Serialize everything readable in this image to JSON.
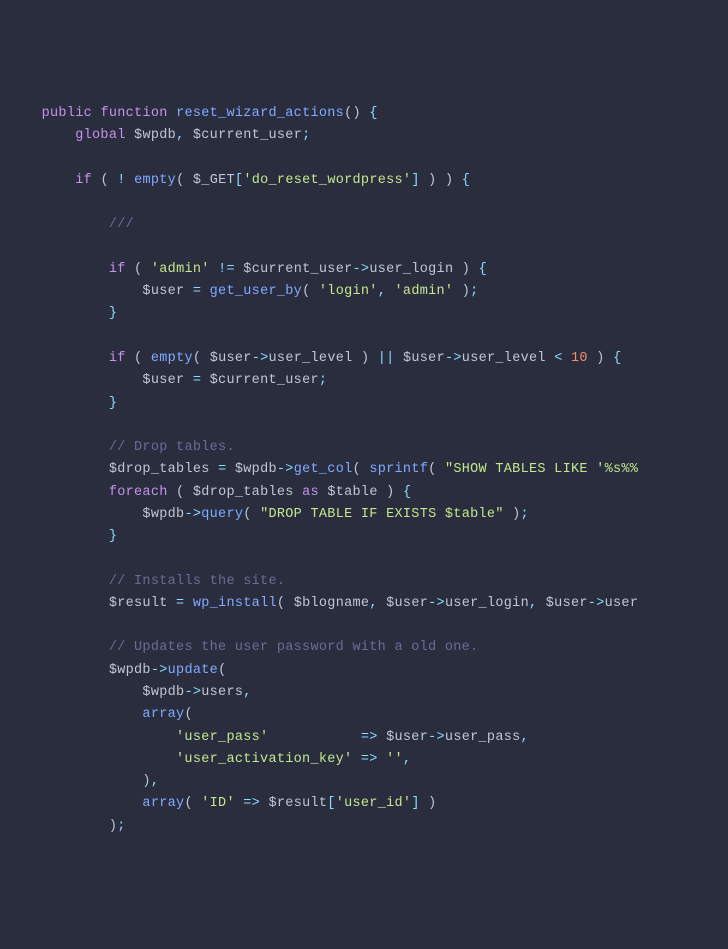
{
  "code": {
    "lines": [
      {
        "indent": 1,
        "tokens": [
          {
            "t": "kw",
            "v": "public"
          },
          {
            "t": "sp",
            "v": " "
          },
          {
            "t": "kw",
            "v": "function"
          },
          {
            "t": "sp",
            "v": " "
          },
          {
            "t": "fn",
            "v": "reset_wizard_actions"
          },
          {
            "t": "paren",
            "v": "()"
          },
          {
            "t": "sp",
            "v": " "
          },
          {
            "t": "punc",
            "v": "{"
          }
        ]
      },
      {
        "indent": 2,
        "tokens": [
          {
            "t": "kw",
            "v": "global"
          },
          {
            "t": "sp",
            "v": " "
          },
          {
            "t": "var",
            "v": "$wpdb"
          },
          {
            "t": "punc",
            "v": ","
          },
          {
            "t": "sp",
            "v": " "
          },
          {
            "t": "var",
            "v": "$current_user"
          },
          {
            "t": "punc",
            "v": ";"
          }
        ]
      },
      {
        "indent": 0,
        "tokens": []
      },
      {
        "indent": 2,
        "tokens": [
          {
            "t": "kw",
            "v": "if"
          },
          {
            "t": "sp",
            "v": " "
          },
          {
            "t": "paren",
            "v": "("
          },
          {
            "t": "sp",
            "v": " "
          },
          {
            "t": "op",
            "v": "!"
          },
          {
            "t": "sp",
            "v": " "
          },
          {
            "t": "fn",
            "v": "empty"
          },
          {
            "t": "paren",
            "v": "("
          },
          {
            "t": "sp",
            "v": " "
          },
          {
            "t": "var",
            "v": "$_GET"
          },
          {
            "t": "punc",
            "v": "["
          },
          {
            "t": "str",
            "v": "'do_reset_wordpress'"
          },
          {
            "t": "punc",
            "v": "]"
          },
          {
            "t": "sp",
            "v": " "
          },
          {
            "t": "paren",
            "v": ")"
          },
          {
            "t": "sp",
            "v": " "
          },
          {
            "t": "paren",
            "v": ")"
          },
          {
            "t": "sp",
            "v": " "
          },
          {
            "t": "punc",
            "v": "{"
          }
        ]
      },
      {
        "indent": 0,
        "tokens": []
      },
      {
        "indent": 3,
        "tokens": [
          {
            "t": "cmt",
            "v": "///"
          }
        ]
      },
      {
        "indent": 0,
        "tokens": []
      },
      {
        "indent": 3,
        "tokens": [
          {
            "t": "kw",
            "v": "if"
          },
          {
            "t": "sp",
            "v": " "
          },
          {
            "t": "paren",
            "v": "("
          },
          {
            "t": "sp",
            "v": " "
          },
          {
            "t": "str",
            "v": "'admin'"
          },
          {
            "t": "sp",
            "v": " "
          },
          {
            "t": "op",
            "v": "!="
          },
          {
            "t": "sp",
            "v": " "
          },
          {
            "t": "var",
            "v": "$current_user"
          },
          {
            "t": "arrow",
            "v": "->"
          },
          {
            "t": "prop",
            "v": "user_login"
          },
          {
            "t": "sp",
            "v": " "
          },
          {
            "t": "paren",
            "v": ")"
          },
          {
            "t": "sp",
            "v": " "
          },
          {
            "t": "punc",
            "v": "{"
          }
        ]
      },
      {
        "indent": 4,
        "tokens": [
          {
            "t": "var",
            "v": "$user"
          },
          {
            "t": "sp",
            "v": " "
          },
          {
            "t": "op",
            "v": "="
          },
          {
            "t": "sp",
            "v": " "
          },
          {
            "t": "fn",
            "v": "get_user_by"
          },
          {
            "t": "paren",
            "v": "("
          },
          {
            "t": "sp",
            "v": " "
          },
          {
            "t": "str",
            "v": "'login'"
          },
          {
            "t": "punc",
            "v": ","
          },
          {
            "t": "sp",
            "v": " "
          },
          {
            "t": "str",
            "v": "'admin'"
          },
          {
            "t": "sp",
            "v": " "
          },
          {
            "t": "paren",
            "v": ")"
          },
          {
            "t": "punc",
            "v": ";"
          }
        ]
      },
      {
        "indent": 3,
        "tokens": [
          {
            "t": "punc",
            "v": "}"
          }
        ]
      },
      {
        "indent": 0,
        "tokens": []
      },
      {
        "indent": 3,
        "tokens": [
          {
            "t": "kw",
            "v": "if"
          },
          {
            "t": "sp",
            "v": " "
          },
          {
            "t": "paren",
            "v": "("
          },
          {
            "t": "sp",
            "v": " "
          },
          {
            "t": "fn",
            "v": "empty"
          },
          {
            "t": "paren",
            "v": "("
          },
          {
            "t": "sp",
            "v": " "
          },
          {
            "t": "var",
            "v": "$user"
          },
          {
            "t": "arrow",
            "v": "->"
          },
          {
            "t": "prop",
            "v": "user_level"
          },
          {
            "t": "sp",
            "v": " "
          },
          {
            "t": "paren",
            "v": ")"
          },
          {
            "t": "sp",
            "v": " "
          },
          {
            "t": "op",
            "v": "||"
          },
          {
            "t": "sp",
            "v": " "
          },
          {
            "t": "var",
            "v": "$user"
          },
          {
            "t": "arrow",
            "v": "->"
          },
          {
            "t": "prop",
            "v": "user_level"
          },
          {
            "t": "sp",
            "v": " "
          },
          {
            "t": "op",
            "v": "<"
          },
          {
            "t": "sp",
            "v": " "
          },
          {
            "t": "num",
            "v": "10"
          },
          {
            "t": "sp",
            "v": " "
          },
          {
            "t": "paren",
            "v": ")"
          },
          {
            "t": "sp",
            "v": " "
          },
          {
            "t": "punc",
            "v": "{"
          }
        ]
      },
      {
        "indent": 4,
        "tokens": [
          {
            "t": "var",
            "v": "$user"
          },
          {
            "t": "sp",
            "v": " "
          },
          {
            "t": "op",
            "v": "="
          },
          {
            "t": "sp",
            "v": " "
          },
          {
            "t": "var",
            "v": "$current_user"
          },
          {
            "t": "punc",
            "v": ";"
          }
        ]
      },
      {
        "indent": 3,
        "tokens": [
          {
            "t": "punc",
            "v": "}"
          }
        ]
      },
      {
        "indent": 0,
        "tokens": []
      },
      {
        "indent": 3,
        "tokens": [
          {
            "t": "cmt",
            "v": "// Drop tables."
          }
        ]
      },
      {
        "indent": 3,
        "tokens": [
          {
            "t": "var",
            "v": "$drop_tables"
          },
          {
            "t": "sp",
            "v": " "
          },
          {
            "t": "op",
            "v": "="
          },
          {
            "t": "sp",
            "v": " "
          },
          {
            "t": "var",
            "v": "$wpdb"
          },
          {
            "t": "arrow",
            "v": "->"
          },
          {
            "t": "fn",
            "v": "get_col"
          },
          {
            "t": "paren",
            "v": "("
          },
          {
            "t": "sp",
            "v": " "
          },
          {
            "t": "fn",
            "v": "sprintf"
          },
          {
            "t": "paren",
            "v": "("
          },
          {
            "t": "sp",
            "v": " "
          },
          {
            "t": "str",
            "v": "\"SHOW TABLES LIKE '%s%%"
          }
        ]
      },
      {
        "indent": 3,
        "tokens": [
          {
            "t": "kw",
            "v": "foreach"
          },
          {
            "t": "sp",
            "v": " "
          },
          {
            "t": "paren",
            "v": "("
          },
          {
            "t": "sp",
            "v": " "
          },
          {
            "t": "var",
            "v": "$drop_tables"
          },
          {
            "t": "sp",
            "v": " "
          },
          {
            "t": "kw",
            "v": "as"
          },
          {
            "t": "sp",
            "v": " "
          },
          {
            "t": "var",
            "v": "$table"
          },
          {
            "t": "sp",
            "v": " "
          },
          {
            "t": "paren",
            "v": ")"
          },
          {
            "t": "sp",
            "v": " "
          },
          {
            "t": "punc",
            "v": "{"
          }
        ]
      },
      {
        "indent": 4,
        "tokens": [
          {
            "t": "var",
            "v": "$wpdb"
          },
          {
            "t": "arrow",
            "v": "->"
          },
          {
            "t": "fn",
            "v": "query"
          },
          {
            "t": "paren",
            "v": "("
          },
          {
            "t": "sp",
            "v": " "
          },
          {
            "t": "str",
            "v": "\"DROP TABLE IF EXISTS $table\""
          },
          {
            "t": "sp",
            "v": " "
          },
          {
            "t": "paren",
            "v": ")"
          },
          {
            "t": "punc",
            "v": ";"
          }
        ]
      },
      {
        "indent": 3,
        "tokens": [
          {
            "t": "punc",
            "v": "}"
          }
        ]
      },
      {
        "indent": 0,
        "tokens": []
      },
      {
        "indent": 3,
        "tokens": [
          {
            "t": "cmt",
            "v": "// Installs the site."
          }
        ]
      },
      {
        "indent": 3,
        "tokens": [
          {
            "t": "var",
            "v": "$result"
          },
          {
            "t": "sp",
            "v": " "
          },
          {
            "t": "op",
            "v": "="
          },
          {
            "t": "sp",
            "v": " "
          },
          {
            "t": "fn",
            "v": "wp_install"
          },
          {
            "t": "paren",
            "v": "("
          },
          {
            "t": "sp",
            "v": " "
          },
          {
            "t": "var",
            "v": "$blogname"
          },
          {
            "t": "punc",
            "v": ","
          },
          {
            "t": "sp",
            "v": " "
          },
          {
            "t": "var",
            "v": "$user"
          },
          {
            "t": "arrow",
            "v": "->"
          },
          {
            "t": "prop",
            "v": "user_login"
          },
          {
            "t": "punc",
            "v": ","
          },
          {
            "t": "sp",
            "v": " "
          },
          {
            "t": "var",
            "v": "$user"
          },
          {
            "t": "arrow",
            "v": "->"
          },
          {
            "t": "prop",
            "v": "user"
          }
        ]
      },
      {
        "indent": 0,
        "tokens": []
      },
      {
        "indent": 3,
        "tokens": [
          {
            "t": "cmt",
            "v": "// Updates the user password with a old one."
          }
        ]
      },
      {
        "indent": 3,
        "tokens": [
          {
            "t": "var",
            "v": "$wpdb"
          },
          {
            "t": "arrow",
            "v": "->"
          },
          {
            "t": "fn",
            "v": "update"
          },
          {
            "t": "paren",
            "v": "("
          }
        ]
      },
      {
        "indent": 4,
        "tokens": [
          {
            "t": "var",
            "v": "$wpdb"
          },
          {
            "t": "arrow",
            "v": "->"
          },
          {
            "t": "prop",
            "v": "users"
          },
          {
            "t": "punc",
            "v": ","
          }
        ]
      },
      {
        "indent": 4,
        "tokens": [
          {
            "t": "fn",
            "v": "array"
          },
          {
            "t": "paren",
            "v": "("
          }
        ]
      },
      {
        "indent": 5,
        "tokens": [
          {
            "t": "str",
            "v": "'user_pass'"
          },
          {
            "t": "sp",
            "v": "           "
          },
          {
            "t": "op",
            "v": "=>"
          },
          {
            "t": "sp",
            "v": " "
          },
          {
            "t": "var",
            "v": "$user"
          },
          {
            "t": "arrow",
            "v": "->"
          },
          {
            "t": "prop",
            "v": "user_pass"
          },
          {
            "t": "punc",
            "v": ","
          }
        ]
      },
      {
        "indent": 5,
        "tokens": [
          {
            "t": "str",
            "v": "'user_activation_key'"
          },
          {
            "t": "sp",
            "v": " "
          },
          {
            "t": "op",
            "v": "=>"
          },
          {
            "t": "sp",
            "v": " "
          },
          {
            "t": "str",
            "v": "''"
          },
          {
            "t": "punc",
            "v": ","
          }
        ]
      },
      {
        "indent": 4,
        "tokens": [
          {
            "t": "paren",
            "v": ")"
          },
          {
            "t": "punc",
            "v": ","
          }
        ]
      },
      {
        "indent": 4,
        "tokens": [
          {
            "t": "fn",
            "v": "array"
          },
          {
            "t": "paren",
            "v": "("
          },
          {
            "t": "sp",
            "v": " "
          },
          {
            "t": "str",
            "v": "'ID'"
          },
          {
            "t": "sp",
            "v": " "
          },
          {
            "t": "op",
            "v": "=>"
          },
          {
            "t": "sp",
            "v": " "
          },
          {
            "t": "var",
            "v": "$result"
          },
          {
            "t": "punc",
            "v": "["
          },
          {
            "t": "str",
            "v": "'user_id'"
          },
          {
            "t": "punc",
            "v": "]"
          },
          {
            "t": "sp",
            "v": " "
          },
          {
            "t": "paren",
            "v": ")"
          }
        ]
      },
      {
        "indent": 3,
        "tokens": [
          {
            "t": "paren",
            "v": ")"
          },
          {
            "t": "punc",
            "v": ";"
          }
        ]
      }
    ],
    "indentStr": "    "
  }
}
